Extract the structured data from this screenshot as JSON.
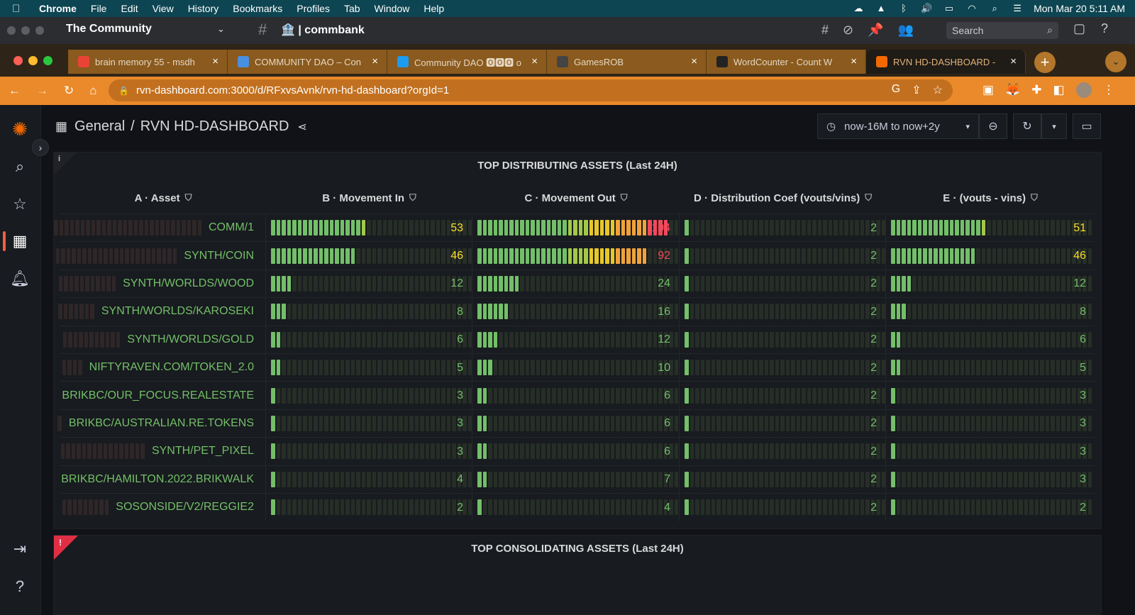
{
  "mac_menubar": {
    "app": "Chrome",
    "items": [
      "File",
      "Edit",
      "View",
      "History",
      "Bookmarks",
      "Profiles",
      "Tab",
      "Window",
      "Help"
    ],
    "clock": "Mon Mar 20  5:11 AM"
  },
  "slack": {
    "workspace": "The Community",
    "channel": "commbank",
    "search_placeholder": "Search"
  },
  "tabs": [
    {
      "title": "brain memory 55 - msdh",
      "favicon": "gmail-icon",
      "color": "#ea4335",
      "active": false
    },
    {
      "title": "COMMUNITY DAO – Con",
      "favicon": "globe-icon",
      "color": "#4a90e2",
      "active": false
    },
    {
      "title": "Community DAO 🅾🅾🅾 o",
      "favicon": "twitter-icon",
      "color": "#1d9bf0",
      "active": false
    },
    {
      "title": "GamesROB",
      "favicon": "game-icon",
      "color": "#444",
      "active": false
    },
    {
      "title": "WordCounter - Count W",
      "favicon": "w-icon",
      "color": "#222",
      "active": false
    },
    {
      "title": "RVN HD-DASHBOARD -",
      "favicon": "grafana-icon",
      "color": "#f46800",
      "active": true
    }
  ],
  "address": {
    "url": "rvn-dashboard.com:3000/d/RFxvsAvnk/rvn-hd-dashboard?orgId=1"
  },
  "dashboard": {
    "breadcrumb_folder": "General",
    "breadcrumb_sep": "/",
    "breadcrumb_title": "RVN HD-DASHBOARD",
    "time_range": "now-16M to now+2y"
  },
  "panel1": {
    "info_mark": "i",
    "title": "TOP DISTRIBUTING ASSETS (Last 24H)",
    "columns": [
      {
        "label": "A · Asset",
        "width": 290
      },
      {
        "label": "B · Movement In",
        "width": 291
      },
      {
        "label": "C · Movement Out",
        "width": 292
      },
      {
        "label": "D · Distribution Coef (vouts/vins)",
        "width": 291
      },
      {
        "label": "E · (vouts - vins)",
        "width": 294
      }
    ],
    "max": {
      "in": 110,
      "out": 110,
      "coef": 110,
      "diff": 110
    },
    "rows": [
      {
        "asset": "COMM/1",
        "in": 53,
        "out": 104,
        "coef": 2,
        "diff": 51,
        "abar": 28
      },
      {
        "asset": "SYNTH/COIN",
        "in": 46,
        "out": 92,
        "coef": 2,
        "diff": 46,
        "abar": 23
      },
      {
        "asset": "SYNTH/WORLDS/WOOD",
        "in": 12,
        "out": 24,
        "coef": 2,
        "diff": 12,
        "abar": 11
      },
      {
        "asset": "SYNTH/WORLDS/KAROSEKI",
        "in": 8,
        "out": 16,
        "coef": 2,
        "diff": 8,
        "abar": 7
      },
      {
        "asset": "SYNTH/WORLDS/GOLD",
        "in": 6,
        "out": 12,
        "coef": 2,
        "diff": 6,
        "abar": 11
      },
      {
        "asset": "NIFTYRAVEN.COM/TOKEN_2.0",
        "in": 5,
        "out": 10,
        "coef": 2,
        "diff": 5,
        "abar": 4
      },
      {
        "asset": "BRIKBC/OUR_FOCUS.REALESTATE",
        "in": 3,
        "out": 6,
        "coef": 2,
        "diff": 3,
        "abar": 0
      },
      {
        "asset": "BRIKBC/AUSTRALIAN.RE.TOKENS",
        "in": 3,
        "out": 6,
        "coef": 2,
        "diff": 3,
        "abar": 1
      },
      {
        "asset": "SYNTH/PET_PIXEL",
        "in": 3,
        "out": 6,
        "coef": 2,
        "diff": 3,
        "abar": 16
      },
      {
        "asset": "BRIKBC/HAMILTON.2022.BRIKWALK",
        "in": 4,
        "out": 7,
        "coef": 2,
        "diff": 3,
        "abar": 0
      },
      {
        "asset": "SOSONSIDE/V2/REGGIE2",
        "in": 2,
        "out": 4,
        "coef": 2,
        "diff": 2,
        "abar": 9
      }
    ]
  },
  "panel2": {
    "error_mark": "!",
    "title": "TOP CONSOLIDATING ASSETS (Last 24H)"
  },
  "colors": {
    "green": "#73bf69",
    "yellow": "#fade2a",
    "red": "#f2495c",
    "accent": "#f46800"
  }
}
